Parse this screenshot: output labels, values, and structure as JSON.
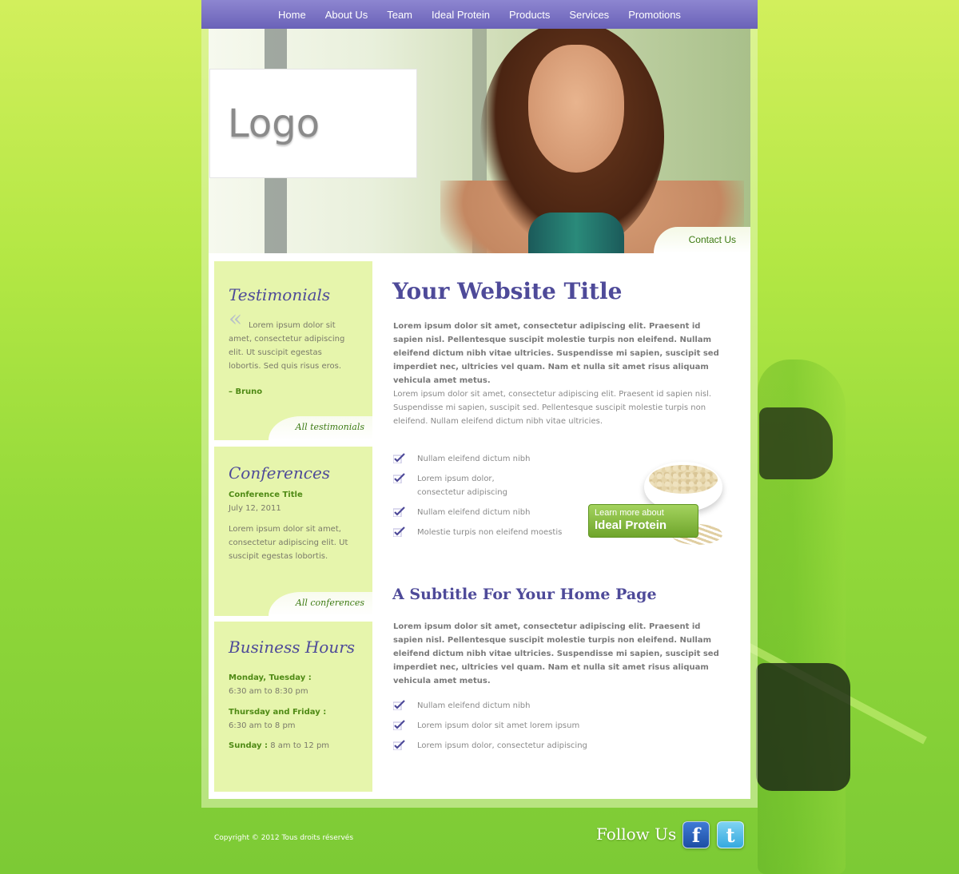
{
  "nav": {
    "items": [
      "Home",
      "About Us",
      "Team",
      "Ideal Protein",
      "Products",
      "Services",
      "Promotions"
    ]
  },
  "header": {
    "logo": "Logo",
    "contact": "Contact Us"
  },
  "sidebar": {
    "testimonials": {
      "title": "Testimonials",
      "quote": "Lorem ipsum dolor sit amet, consectetur adipiscing elit. Ut suscipit egestas lobortis. Sed quis risus eros.",
      "author": "– Bruno",
      "link": "All testimonials"
    },
    "conferences": {
      "title": "Conferences",
      "item_title": "Conference Title",
      "date": "July 12, 2011",
      "text": "Lorem ipsum dolor sit amet, consectetur adipiscing elit. Ut suscipit egestas lobortis.",
      "link": "All conferences"
    },
    "hours": {
      "title": "Business Hours",
      "mon_label": "Monday, Tuesday :",
      "mon_time": "6:30 am to 8:30 pm",
      "thu_label": "Thursday and Friday :",
      "thu_time": "6:30 am to 8 pm",
      "sun_label": "Sunday :",
      "sun_time": "8 am to 12 pm"
    }
  },
  "main": {
    "title": "Your Website Title",
    "intro_bold": "Lorem ipsum dolor sit amet, consectetur adipiscing elit. Praesent id sapien nisl. Pellentesque suscipit molestie turpis non eleifend. Nullam eleifend dictum nibh vitae ultricies. Suspendisse mi sapien, suscipit sed imperdiet nec, ultricies vel quam. Nam et nulla sit amet risus aliquam vehicula amet metus.",
    "intro_regular": "Lorem ipsum dolor sit amet, consectetur adipiscing elit. Praesent id sapien nisl. Suspendisse mi sapien, suscipit sed. Pellentesque suscipit molestie turpis non eleifend. Nullam eleifend dictum nibh vitae ultricies.",
    "list1": [
      "Nullam eleifend dictum nibh",
      "Lorem ipsum dolor, consectetur adipiscing",
      "Nullam eleifend dictum nibh",
      "Molestie turpis non eleifend moestis"
    ],
    "promo_small": "Learn more about",
    "promo_big": "Ideal Protein",
    "subtitle": "A Subtitle For Your Home Page",
    "body_bold": "Lorem ipsum dolor sit amet, consectetur adipiscing elit. Praesent id sapien nisl. Pellentesque suscipit molestie turpis non eleifend. Nullam eleifend dictum nibh vitae ultricies. Suspendisse mi sapien, suscipit sed imperdiet nec, ultricies vel quam. Nam et nulla sit amet risus aliquam vehicula amet metus.",
    "list2": [
      "Nullam eleifend dictum nibh",
      "Lorem ipsum dolor sit amet lorem ipsum",
      "Lorem ipsum dolor, consectetur adipiscing"
    ]
  },
  "footer": {
    "copyright": "Copyright © 2012 Tous droits réservés",
    "follow": "Follow Us",
    "facebook_glyph": "f",
    "twitter_glyph": "t"
  },
  "colors": {
    "nav": "#7a72c4",
    "title": "#4e4a99",
    "accent_green": "#4f8a15",
    "sidebar_bg": "#e6f5ac"
  }
}
